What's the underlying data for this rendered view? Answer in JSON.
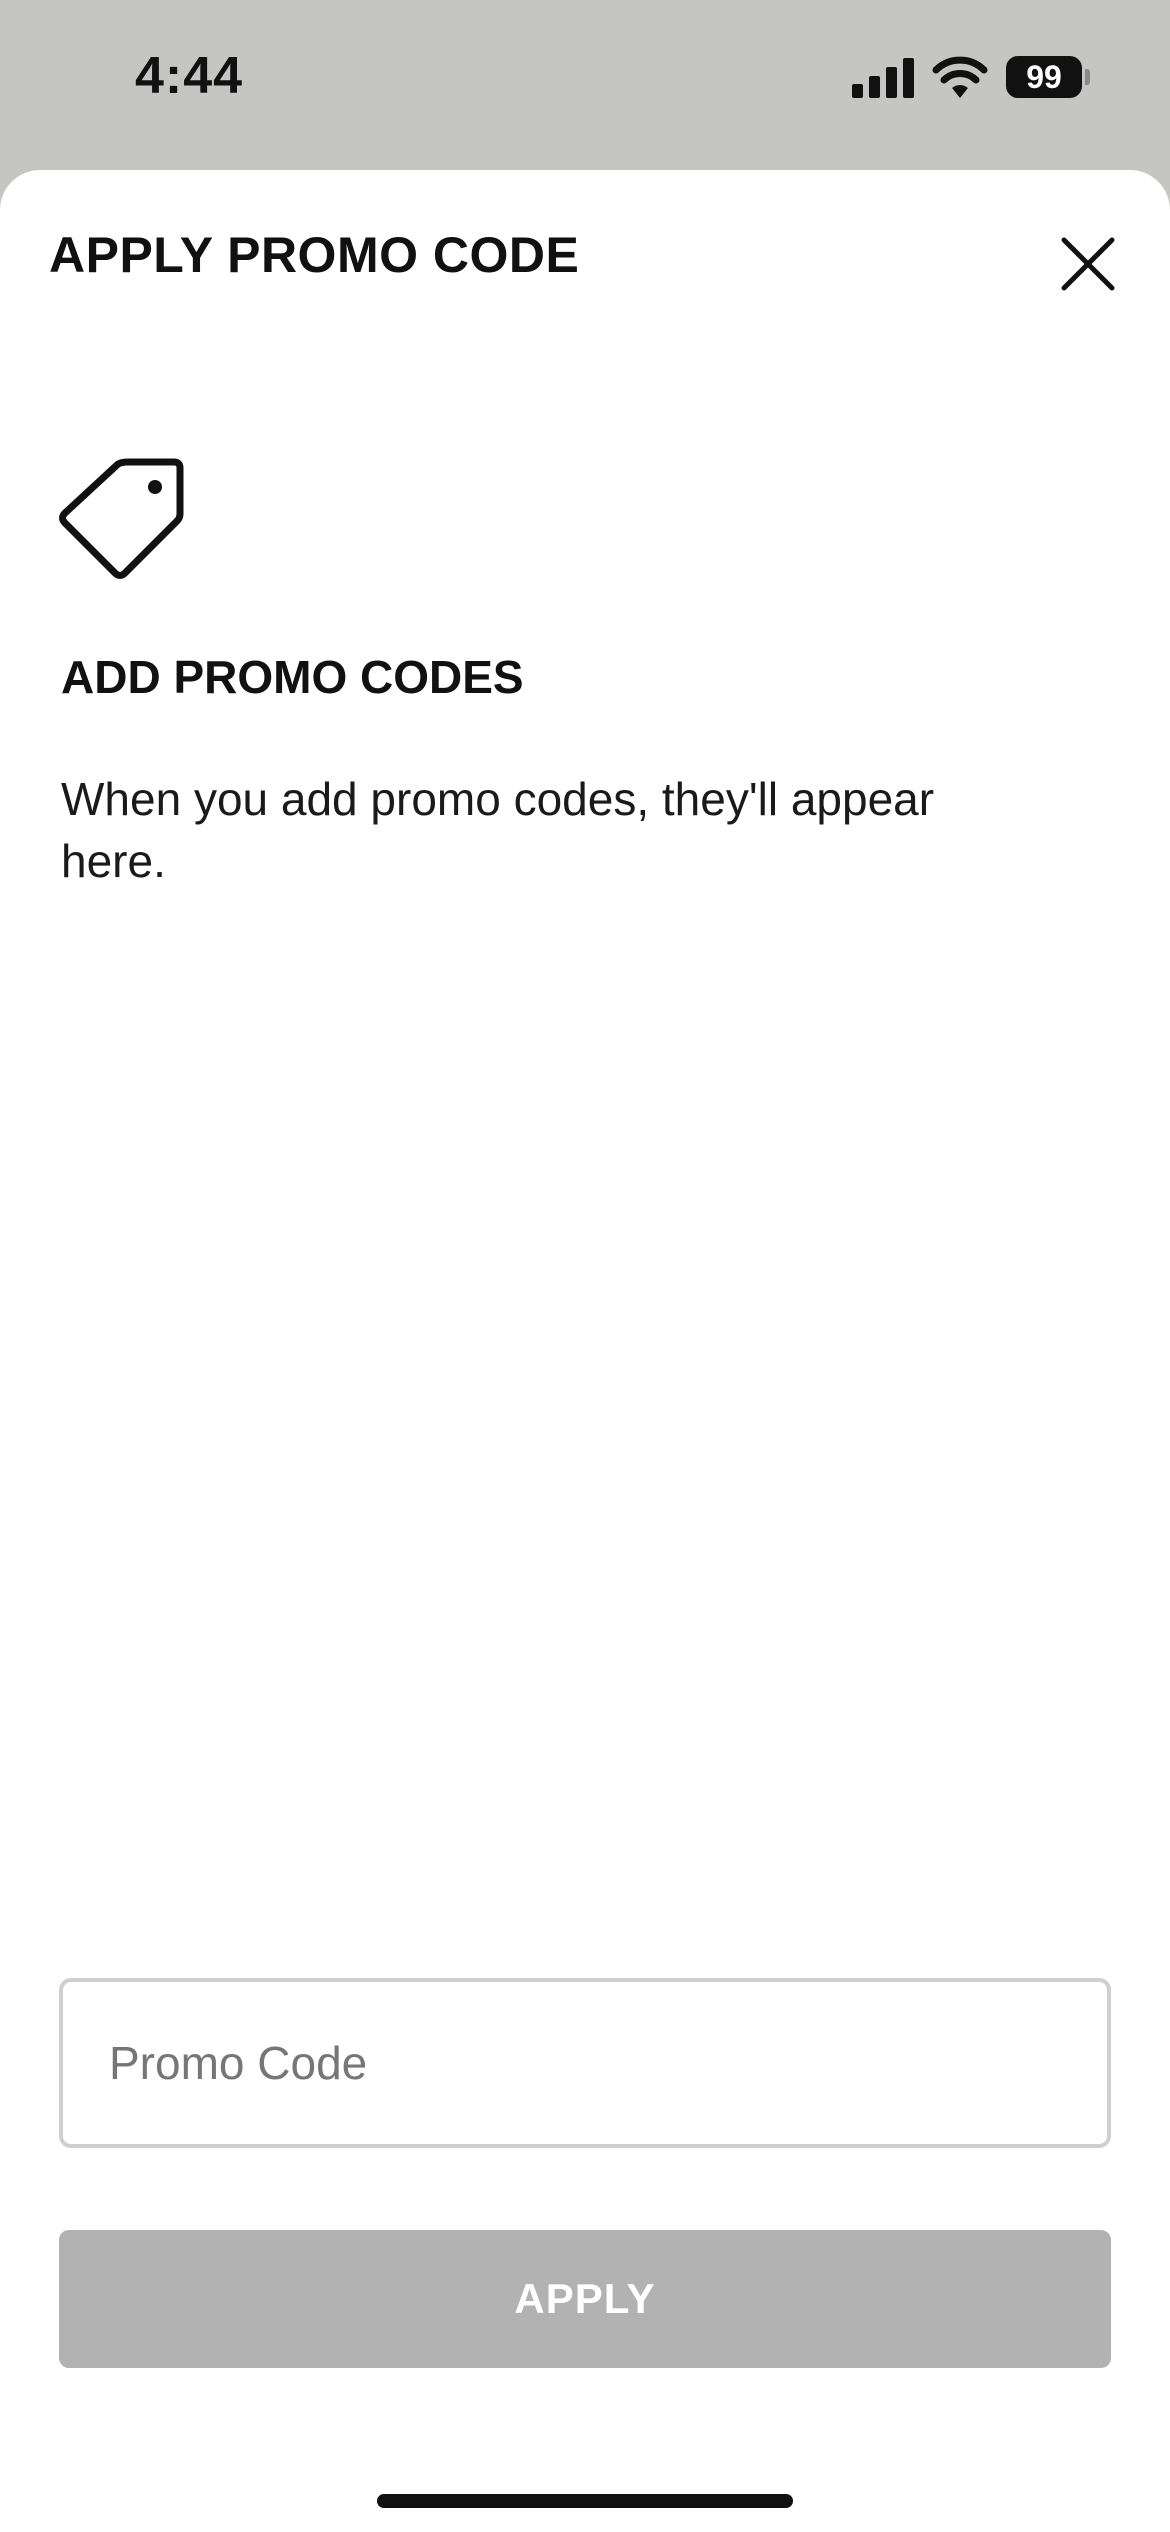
{
  "status_bar": {
    "time": "4:44",
    "battery_level": "99"
  },
  "sheet": {
    "title": "APPLY PROMO CODE",
    "close_icon": "close-icon",
    "empty_state": {
      "icon": "tag-icon",
      "heading": "ADD PROMO CODES",
      "description": "When you add promo codes, they'll appear here."
    },
    "promo_input": {
      "value": "",
      "placeholder": "Promo Code"
    },
    "apply_button": {
      "label": "APPLY",
      "enabled": false,
      "color": "#b2b2b2"
    }
  }
}
